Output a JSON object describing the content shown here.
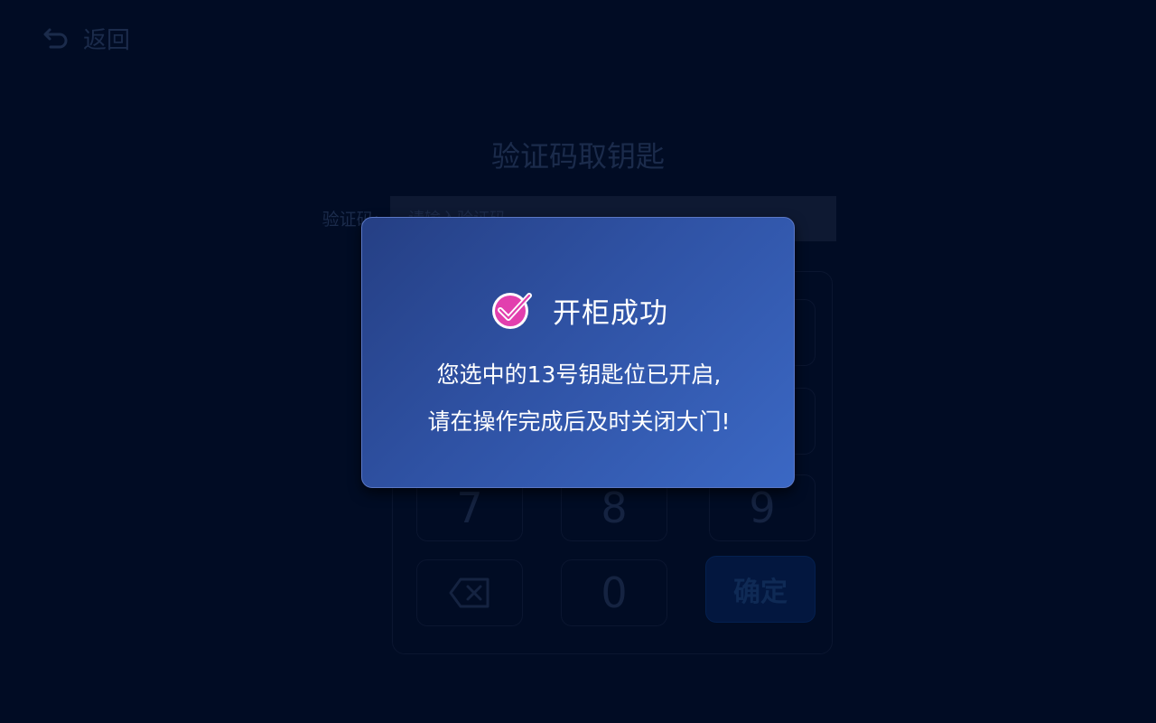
{
  "header": {
    "back_label": "返回",
    "back_icon": "undo-arrow-icon"
  },
  "page": {
    "title": "验证码取钥匙",
    "code_label": "验证码:",
    "code_placeholder": "请输入验证码",
    "code_value": ""
  },
  "keypad": {
    "keys": [
      "7",
      "8",
      "9",
      "0"
    ],
    "delete_icon": "backspace-icon",
    "confirm_label": "确定"
  },
  "modal": {
    "icon": "check-circle-icon",
    "icon_color": "#e23fae",
    "title": "开柜成功",
    "message_line1": "您选中的13号钥匙位已开启,",
    "message_line2": "请在操作完成后及时关闭大门!"
  },
  "colors": {
    "background": "#010c24",
    "modal_gradient_start": "#253f84",
    "modal_gradient_end": "#3b68c4",
    "confirm_button": "#03173f"
  }
}
